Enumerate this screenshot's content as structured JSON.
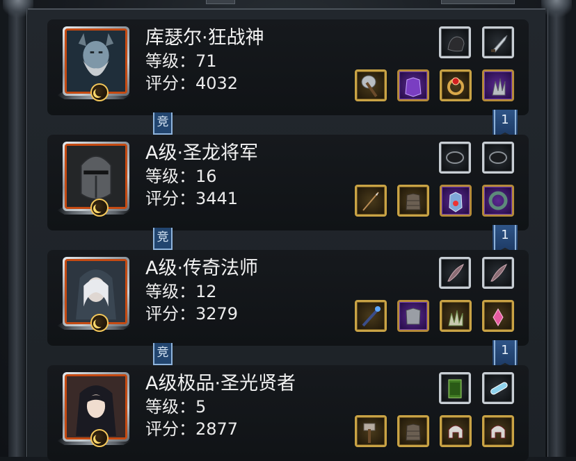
{
  "heroes": [
    {
      "name": "库瑟尔·狂战神",
      "level_text": "等级：71",
      "score_text": "评分：4032",
      "rank_tag": "竞",
      "badge": "1",
      "portrait": "horned-bearded-warrior-portrait",
      "top_slots": [
        {
          "item": "dark-gauntlet-icon",
          "frame": "silver"
        },
        {
          "item": "dagger-icon",
          "frame": "silver"
        }
      ],
      "bottom_slots": [
        {
          "item": "battle-axe-icon",
          "frame": "gold"
        },
        {
          "item": "purple-armor-icon",
          "frame": "purple"
        },
        {
          "item": "ruby-ring-icon",
          "frame": "gold"
        },
        {
          "item": "claw-gauntlet-icon",
          "frame": "purple"
        }
      ]
    },
    {
      "name": "A级·圣龙将军",
      "level_text": "等级：16",
      "score_text": "评分：3441",
      "rank_tag": "竞",
      "badge": "1",
      "portrait": "iron-helmet-knight-portrait",
      "top_slots": [
        {
          "item": "dark-stone-icon",
          "frame": "silver"
        },
        {
          "item": "dark-stone-icon",
          "frame": "silver"
        }
      ],
      "bottom_slots": [
        {
          "item": "spear-icon",
          "frame": "gold"
        },
        {
          "item": "leather-armor-icon",
          "frame": "gold"
        },
        {
          "item": "blue-crystal-armor-icon",
          "frame": "purple"
        },
        {
          "item": "jade-ring-icon",
          "frame": "purple"
        }
      ]
    },
    {
      "name": "A级·传奇法师",
      "level_text": "等级：12",
      "score_text": "评分：3279",
      "rank_tag": "竞",
      "badge": "1",
      "portrait": "hooded-mage-woman-portrait",
      "top_slots": [
        {
          "item": "feather-icon",
          "frame": "silver"
        },
        {
          "item": "feather-icon",
          "frame": "silver"
        }
      ],
      "bottom_slots": [
        {
          "item": "staff-icon",
          "frame": "gold"
        },
        {
          "item": "chest-armor-icon",
          "frame": "purple"
        },
        {
          "item": "bone-claw-icon",
          "frame": "gold"
        },
        {
          "item": "pink-amulet-icon",
          "frame": "gold"
        }
      ]
    },
    {
      "name": "A级极品·圣光贤者",
      "level_text": "等级：5",
      "score_text": "评分：2877",
      "rank_tag": "",
      "badge": "",
      "portrait": "veiled-saint-woman-portrait",
      "top_slots": [
        {
          "item": "green-scroll-icon",
          "frame": "silver"
        },
        {
          "item": "blue-charm-icon",
          "frame": "silver"
        }
      ],
      "bottom_slots": [
        {
          "item": "war-hammer-icon",
          "frame": "gold"
        },
        {
          "item": "leather-armor-icon",
          "frame": "gold"
        },
        {
          "item": "red-helmet-icon",
          "frame": "gold"
        },
        {
          "item": "red-helmet-icon",
          "frame": "gold"
        }
      ]
    }
  ]
}
